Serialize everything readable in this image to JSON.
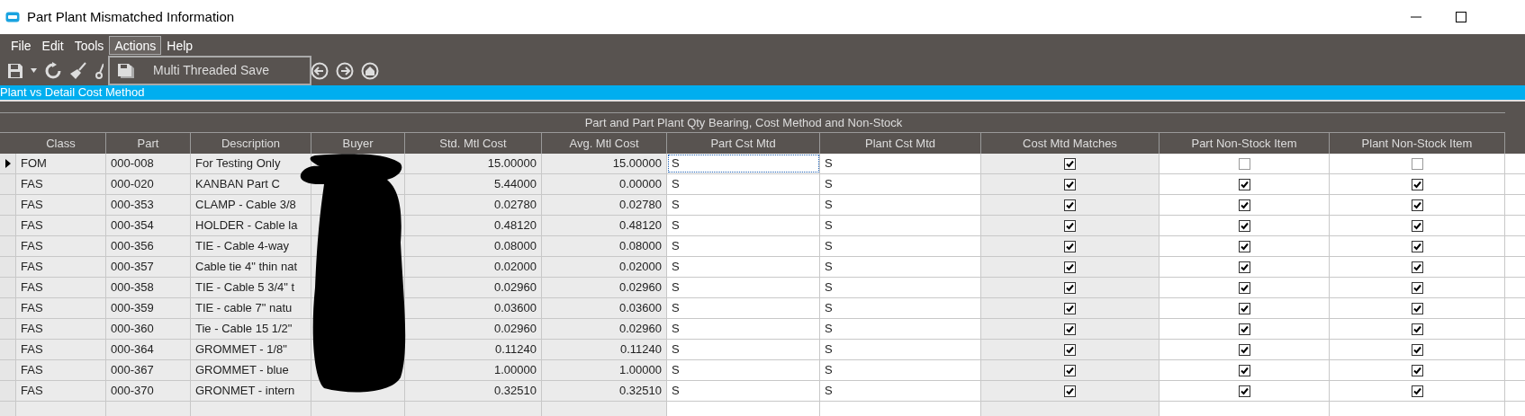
{
  "window": {
    "title": "Part Plant Mismatched Information"
  },
  "menu": [
    {
      "label": "File",
      "selected": false
    },
    {
      "label": "Edit",
      "selected": false
    },
    {
      "label": "Tools",
      "selected": false
    },
    {
      "label": "Actions",
      "selected": true
    },
    {
      "label": "Help",
      "selected": false
    }
  ],
  "dropdown": {
    "items": [
      "Multi Threaded Save"
    ]
  },
  "section_title": "Plant vs Detail Cost Method",
  "group_header": "Part and Part Plant Qty Bearing, Cost Method and Non-Stock",
  "columns": [
    "Class",
    "Part",
    "Description",
    "Buyer",
    "Std. Mtl Cost",
    "Avg. Mtl Cost",
    "Part Cst Mtd",
    "Plant Cst Mtd",
    "Cost Mtd Matches",
    "Part Non-Stock Item",
    "Plant Non-Stock Item"
  ],
  "rows": [
    {
      "selected": true,
      "class": "FOM",
      "part": "000-008",
      "description": "For Testing Only",
      "std_cost": "15.00000",
      "avg_cost": "15.00000",
      "part_cst_mtd": "S",
      "plant_cst_mtd": "S",
      "cost_mtd_matches": true,
      "part_non_stock": false,
      "plant_non_stock": false
    },
    {
      "selected": false,
      "class": "FAS",
      "part": "000-020",
      "description": "KANBAN Part C",
      "std_cost": "5.44000",
      "avg_cost": "0.00000",
      "part_cst_mtd": "S",
      "plant_cst_mtd": "S",
      "cost_mtd_matches": true,
      "part_non_stock": true,
      "plant_non_stock": true
    },
    {
      "selected": false,
      "class": "FAS",
      "part": "000-353",
      "description": "CLAMP - Cable 3/8",
      "std_cost": "0.02780",
      "avg_cost": "0.02780",
      "part_cst_mtd": "S",
      "plant_cst_mtd": "S",
      "cost_mtd_matches": true,
      "part_non_stock": true,
      "plant_non_stock": true
    },
    {
      "selected": false,
      "class": "FAS",
      "part": "000-354",
      "description": "HOLDER - Cable la",
      "std_cost": "0.48120",
      "avg_cost": "0.48120",
      "part_cst_mtd": "S",
      "plant_cst_mtd": "S",
      "cost_mtd_matches": true,
      "part_non_stock": true,
      "plant_non_stock": true
    },
    {
      "selected": false,
      "class": "FAS",
      "part": "000-356",
      "description": "TIE - Cable 4-way",
      "std_cost": "0.08000",
      "avg_cost": "0.08000",
      "part_cst_mtd": "S",
      "plant_cst_mtd": "S",
      "cost_mtd_matches": true,
      "part_non_stock": true,
      "plant_non_stock": true
    },
    {
      "selected": false,
      "class": "FAS",
      "part": "000-357",
      "description": "Cable tie 4\" thin nat",
      "std_cost": "0.02000",
      "avg_cost": "0.02000",
      "part_cst_mtd": "S",
      "plant_cst_mtd": "S",
      "cost_mtd_matches": true,
      "part_non_stock": true,
      "plant_non_stock": true
    },
    {
      "selected": false,
      "class": "FAS",
      "part": "000-358",
      "description": "TIE - Cable 5 3/4\"  t",
      "std_cost": "0.02960",
      "avg_cost": "0.02960",
      "part_cst_mtd": "S",
      "plant_cst_mtd": "S",
      "cost_mtd_matches": true,
      "part_non_stock": true,
      "plant_non_stock": true
    },
    {
      "selected": false,
      "class": "FAS",
      "part": "000-359",
      "description": "TIE - cable 7\"  natu",
      "std_cost": "0.03600",
      "avg_cost": "0.03600",
      "part_cst_mtd": "S",
      "plant_cst_mtd": "S",
      "cost_mtd_matches": true,
      "part_non_stock": true,
      "plant_non_stock": true
    },
    {
      "selected": false,
      "class": "FAS",
      "part": "000-360",
      "description": "Tie - Cable 15 1/2\"",
      "std_cost": "0.02960",
      "avg_cost": "0.02960",
      "part_cst_mtd": "S",
      "plant_cst_mtd": "S",
      "cost_mtd_matches": true,
      "part_non_stock": true,
      "plant_non_stock": true
    },
    {
      "selected": false,
      "class": "FAS",
      "part": "000-364",
      "description": "GROMMET - 1/8\"",
      "std_cost": "0.11240",
      "avg_cost": "0.11240",
      "part_cst_mtd": "S",
      "plant_cst_mtd": "S",
      "cost_mtd_matches": true,
      "part_non_stock": true,
      "plant_non_stock": true
    },
    {
      "selected": false,
      "class": "FAS",
      "part": "000-367",
      "description": "GROMMET - blue",
      "std_cost": "1.00000",
      "avg_cost": "1.00000",
      "part_cst_mtd": "S",
      "plant_cst_mtd": "S",
      "cost_mtd_matches": true,
      "part_non_stock": true,
      "plant_non_stock": true
    },
    {
      "selected": false,
      "class": "FAS",
      "part": "000-370",
      "description": "GRONMET - intern",
      "std_cost": "0.32510",
      "avg_cost": "0.32510",
      "part_cst_mtd": "S",
      "plant_cst_mtd": "S",
      "cost_mtd_matches": true,
      "part_non_stock": true,
      "plant_non_stock": true
    }
  ]
}
